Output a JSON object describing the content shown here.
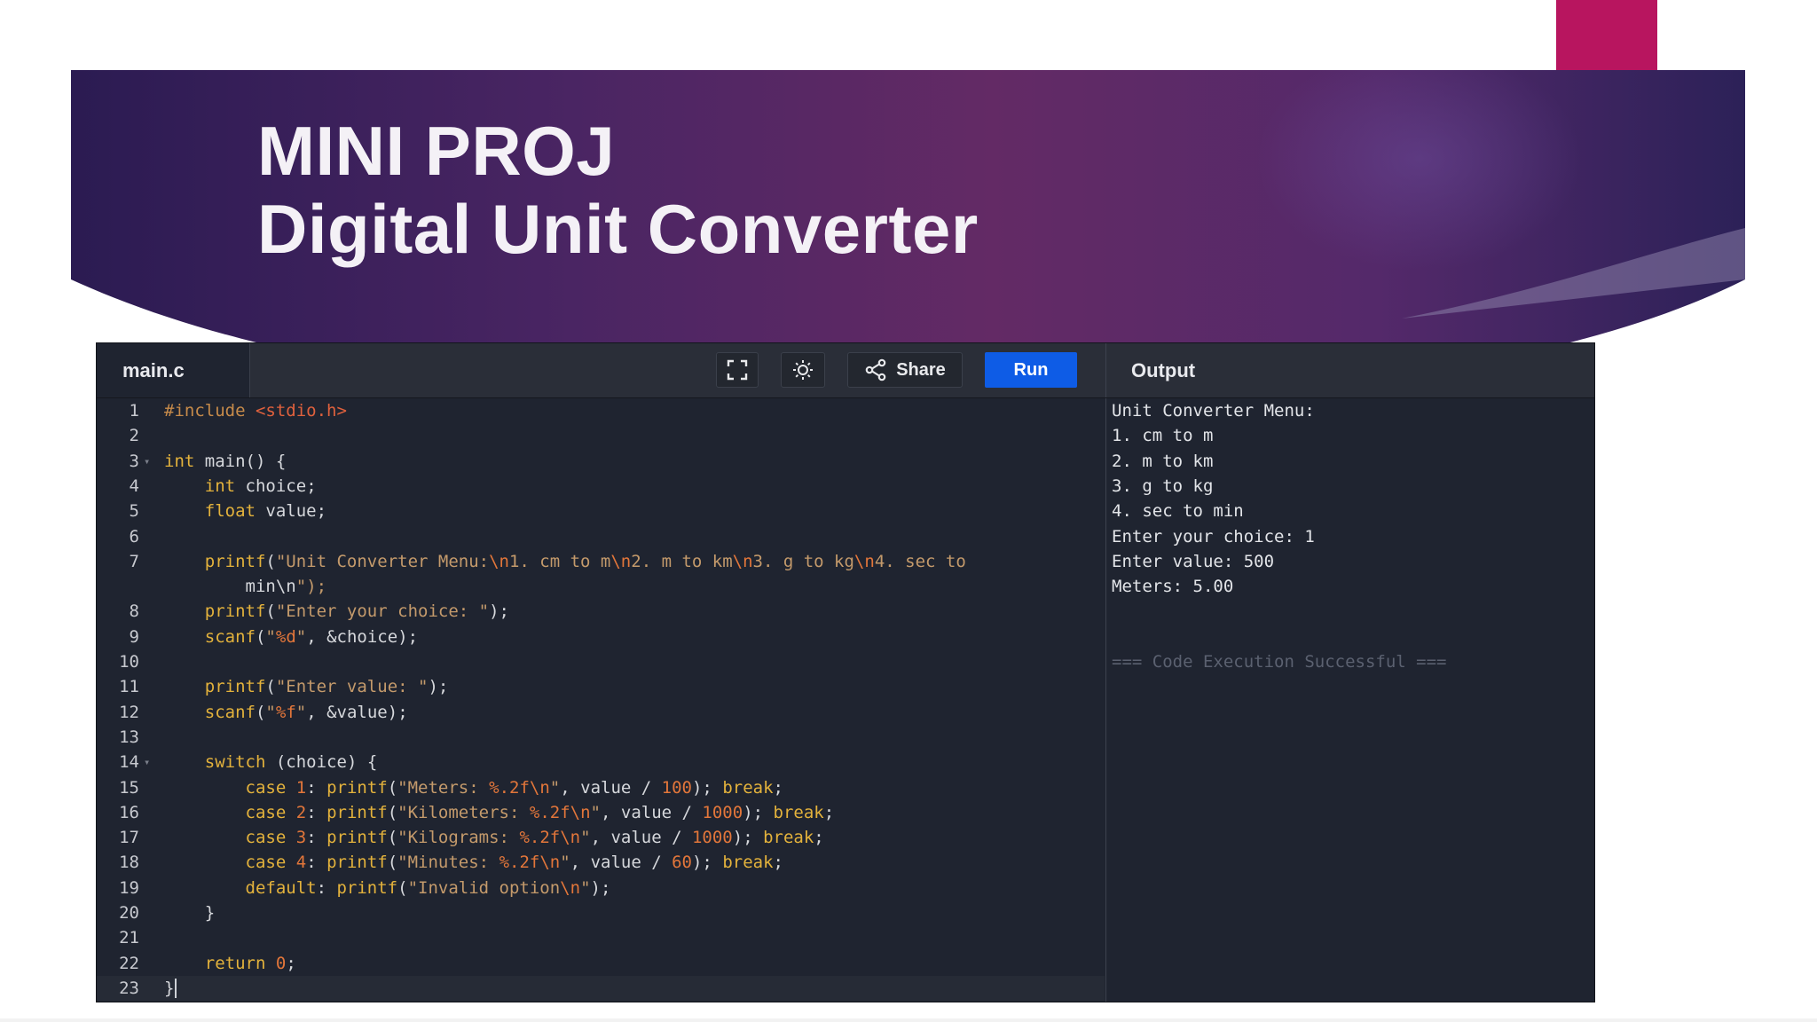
{
  "slide": {
    "title_line1": "MINI PROJ",
    "title_line2": "Digital Unit Converter"
  },
  "colors": {
    "accent_magenta": "#b8155f",
    "banner_dark": "#2b1b52",
    "banner_mid": "#632a65",
    "run_button": "#0e5ce6",
    "editor_bg": "#1f2430"
  },
  "ide": {
    "file_tab": "main.c",
    "toolbar": {
      "fullscreen_icon": "fullscreen-icon",
      "theme_icon": "sun-icon",
      "share_icon": "share-icon",
      "share_label": "Share",
      "run_label": "Run"
    },
    "output_title": "Output"
  },
  "code_lines": [
    {
      "n": "1",
      "text": "#include <stdio.h>"
    },
    {
      "n": "2",
      "text": ""
    },
    {
      "n": "3",
      "text": "int main() {"
    },
    {
      "n": "4",
      "text": "    int choice;"
    },
    {
      "n": "5",
      "text": "    float value;"
    },
    {
      "n": "6",
      "text": ""
    },
    {
      "n": "7",
      "text": "    printf(\"Unit Converter Menu:\\n1. cm to m\\n2. m to km\\n3. g to kg\\n4. sec to"
    },
    {
      "n": "",
      "text": "        min\\n\");"
    },
    {
      "n": "8",
      "text": "    printf(\"Enter your choice: \");"
    },
    {
      "n": "9",
      "text": "    scanf(\"%d\", &choice);"
    },
    {
      "n": "10",
      "text": ""
    },
    {
      "n": "11",
      "text": "    printf(\"Enter value: \");"
    },
    {
      "n": "12",
      "text": "    scanf(\"%f\", &value);"
    },
    {
      "n": "13",
      "text": ""
    },
    {
      "n": "14",
      "text": "    switch (choice) {"
    },
    {
      "n": "15",
      "text": "        case 1: printf(\"Meters: %.2f\\n\", value / 100); break;"
    },
    {
      "n": "16",
      "text": "        case 2: printf(\"Kilometers: %.2f\\n\", value / 1000); break;"
    },
    {
      "n": "17",
      "text": "        case 3: printf(\"Kilograms: %.2f\\n\", value / 1000); break;"
    },
    {
      "n": "18",
      "text": "        case 4: printf(\"Minutes: %.2f\\n\", value / 60); break;"
    },
    {
      "n": "19",
      "text": "        default: printf(\"Invalid option\\n\");"
    },
    {
      "n": "20",
      "text": "    }"
    },
    {
      "n": "21",
      "text": ""
    },
    {
      "n": "22",
      "text": "    return 0;"
    },
    {
      "n": "23",
      "text": "}"
    }
  ],
  "output_lines": [
    "Unit Converter Menu:",
    "1. cm to m",
    "2. m to km",
    "3. g to kg",
    "4. sec to min",
    "Enter your choice: 1",
    "Enter value: 500",
    "Meters: 5.00",
    "",
    "",
    "=== Code Execution Successful ==="
  ]
}
